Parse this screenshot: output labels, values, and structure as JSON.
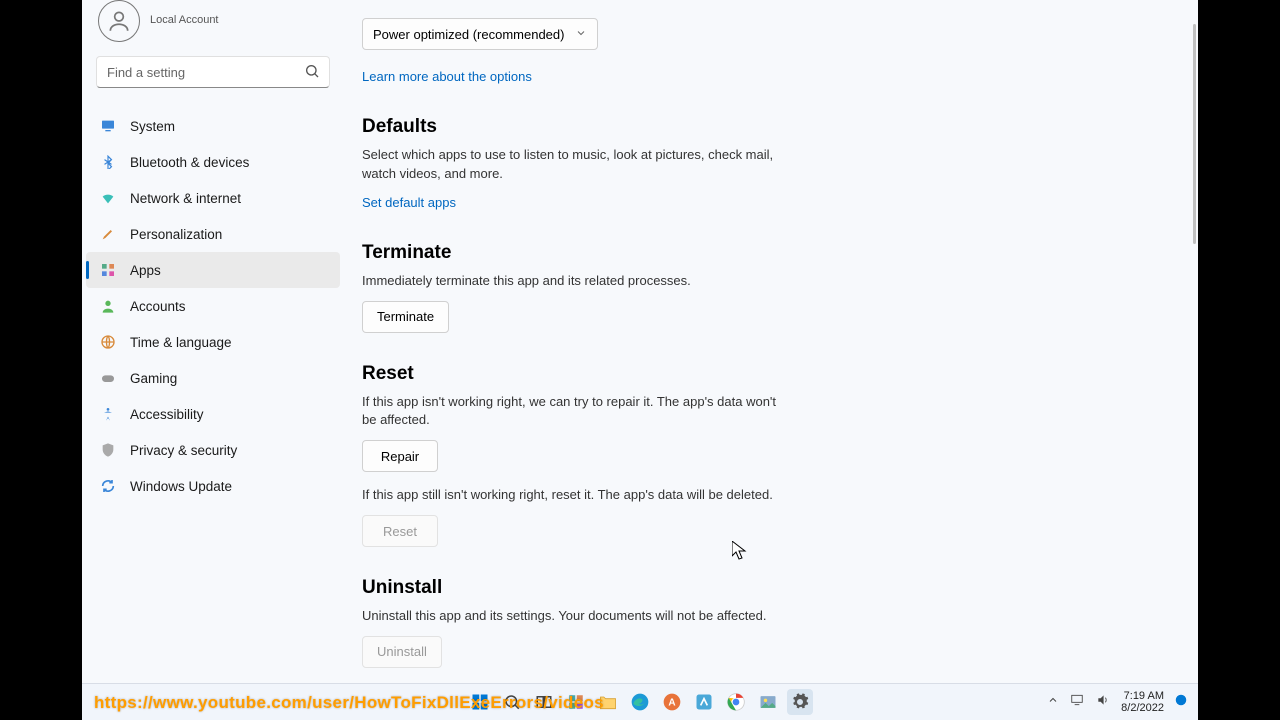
{
  "profile": {
    "sub": "Local Account"
  },
  "search": {
    "placeholder": "Find a setting"
  },
  "nav": [
    {
      "label": "System"
    },
    {
      "label": "Bluetooth & devices"
    },
    {
      "label": "Network & internet"
    },
    {
      "label": "Personalization"
    },
    {
      "label": "Apps"
    },
    {
      "label": "Accounts"
    },
    {
      "label": "Time & language"
    },
    {
      "label": "Gaming"
    },
    {
      "label": "Accessibility"
    },
    {
      "label": "Privacy & security"
    },
    {
      "label": "Windows Update"
    }
  ],
  "dropdown": {
    "value": "Power optimized (recommended)"
  },
  "links": {
    "options": "Learn more about the options",
    "defaults": "Set default apps"
  },
  "defaults": {
    "title": "Defaults",
    "desc": "Select which apps to use to listen to music, look at pictures, check mail, watch videos, and more."
  },
  "terminate": {
    "title": "Terminate",
    "desc": "Immediately terminate this app and its related processes.",
    "btn": "Terminate"
  },
  "reset": {
    "title": "Reset",
    "desc1": "If this app isn't working right, we can try to repair it. The app's data won't be affected.",
    "repair_btn": "Repair",
    "desc2": "If this app still isn't working right, reset it. The app's data will be deleted.",
    "reset_btn": "Reset"
  },
  "uninstall": {
    "title": "Uninstall",
    "desc": "Uninstall this app and its settings. Your documents will not be affected.",
    "btn": "Uninstall"
  },
  "clock": {
    "time": "7:19 AM",
    "date": "8/2/2022"
  },
  "overlay_url": "https://www.youtube.com/user/HowToFixDllExeErrors/videos"
}
